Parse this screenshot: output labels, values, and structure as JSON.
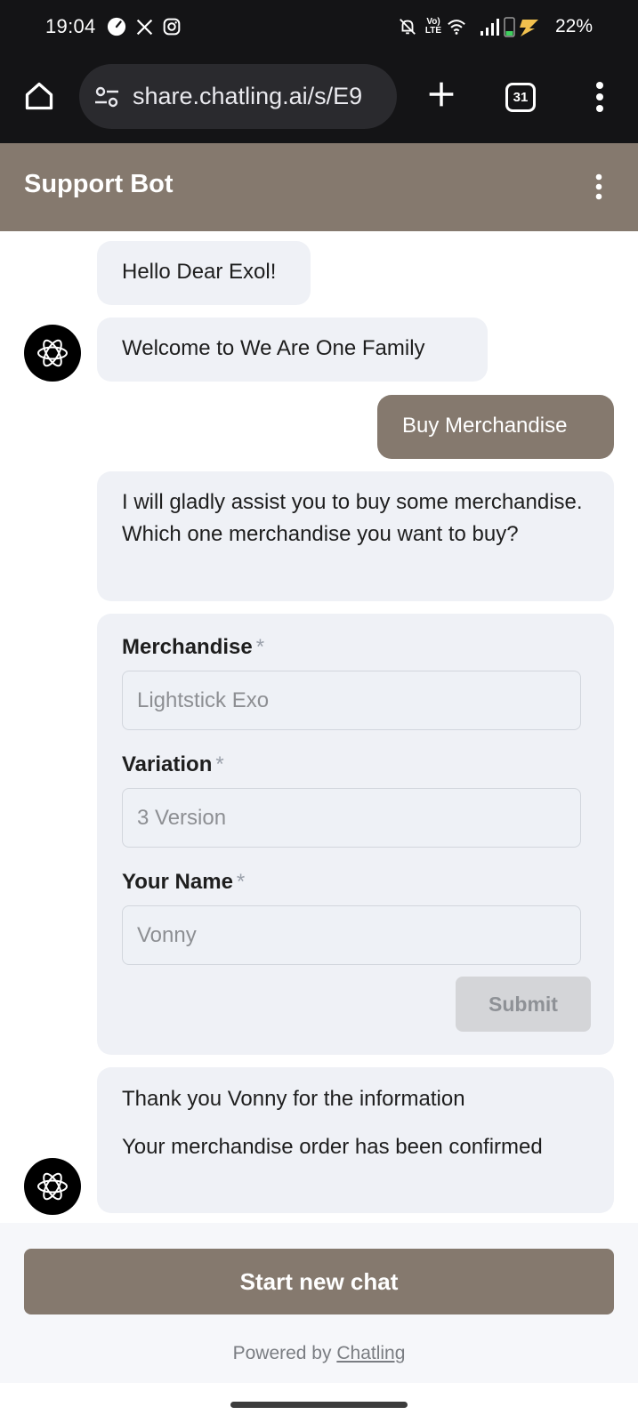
{
  "status_bar": {
    "time": "19:04",
    "battery_percent": "22%",
    "volte_text": "Vo) LTE",
    "icons": [
      "speedometer-icon",
      "x-logo-icon",
      "instagram-icon",
      "bell-off-icon",
      "wifi-icon",
      "signal-icon",
      "battery-charging-icon"
    ]
  },
  "browser": {
    "url": "share.chatling.ai/s/E9",
    "tab_count": "31",
    "icons": [
      "home-icon",
      "site-settings-icon",
      "new-tab-icon",
      "overflow-menu-icon"
    ]
  },
  "header": {
    "title": "Support Bot"
  },
  "chat": {
    "messages": [
      {
        "from": "bot",
        "text": "Hello Dear Exol!"
      },
      {
        "from": "bot",
        "text": "Welcome to We Are One Family"
      },
      {
        "from": "user",
        "text": "Buy Merchandise"
      },
      {
        "from": "bot",
        "text": "I will gladly assist you to buy some merchandise. Which one merchandise you want to buy?"
      }
    ],
    "form": {
      "fields": [
        {
          "label": "Merchandise",
          "required_mark": "*",
          "value": "Lightstick Exo"
        },
        {
          "label": "Variation",
          "required_mark": "*",
          "value": "3 Version"
        },
        {
          "label": "Your Name",
          "required_mark": "*",
          "value": "Vonny"
        }
      ],
      "submit_label": "Submit"
    },
    "confirmation": {
      "line1": "Thank you Vonny for the information",
      "line2": "Your merchandise order has been confirmed"
    }
  },
  "footer": {
    "new_chat_label": "Start new chat",
    "powered_by_prefix": "Powered by",
    "powered_by_link": "Chatling"
  },
  "colors": {
    "brand": "#85796e",
    "bubble_bg": "#eff1f6",
    "system_bar": "#141416",
    "battery_accent": "#f2c14e"
  }
}
